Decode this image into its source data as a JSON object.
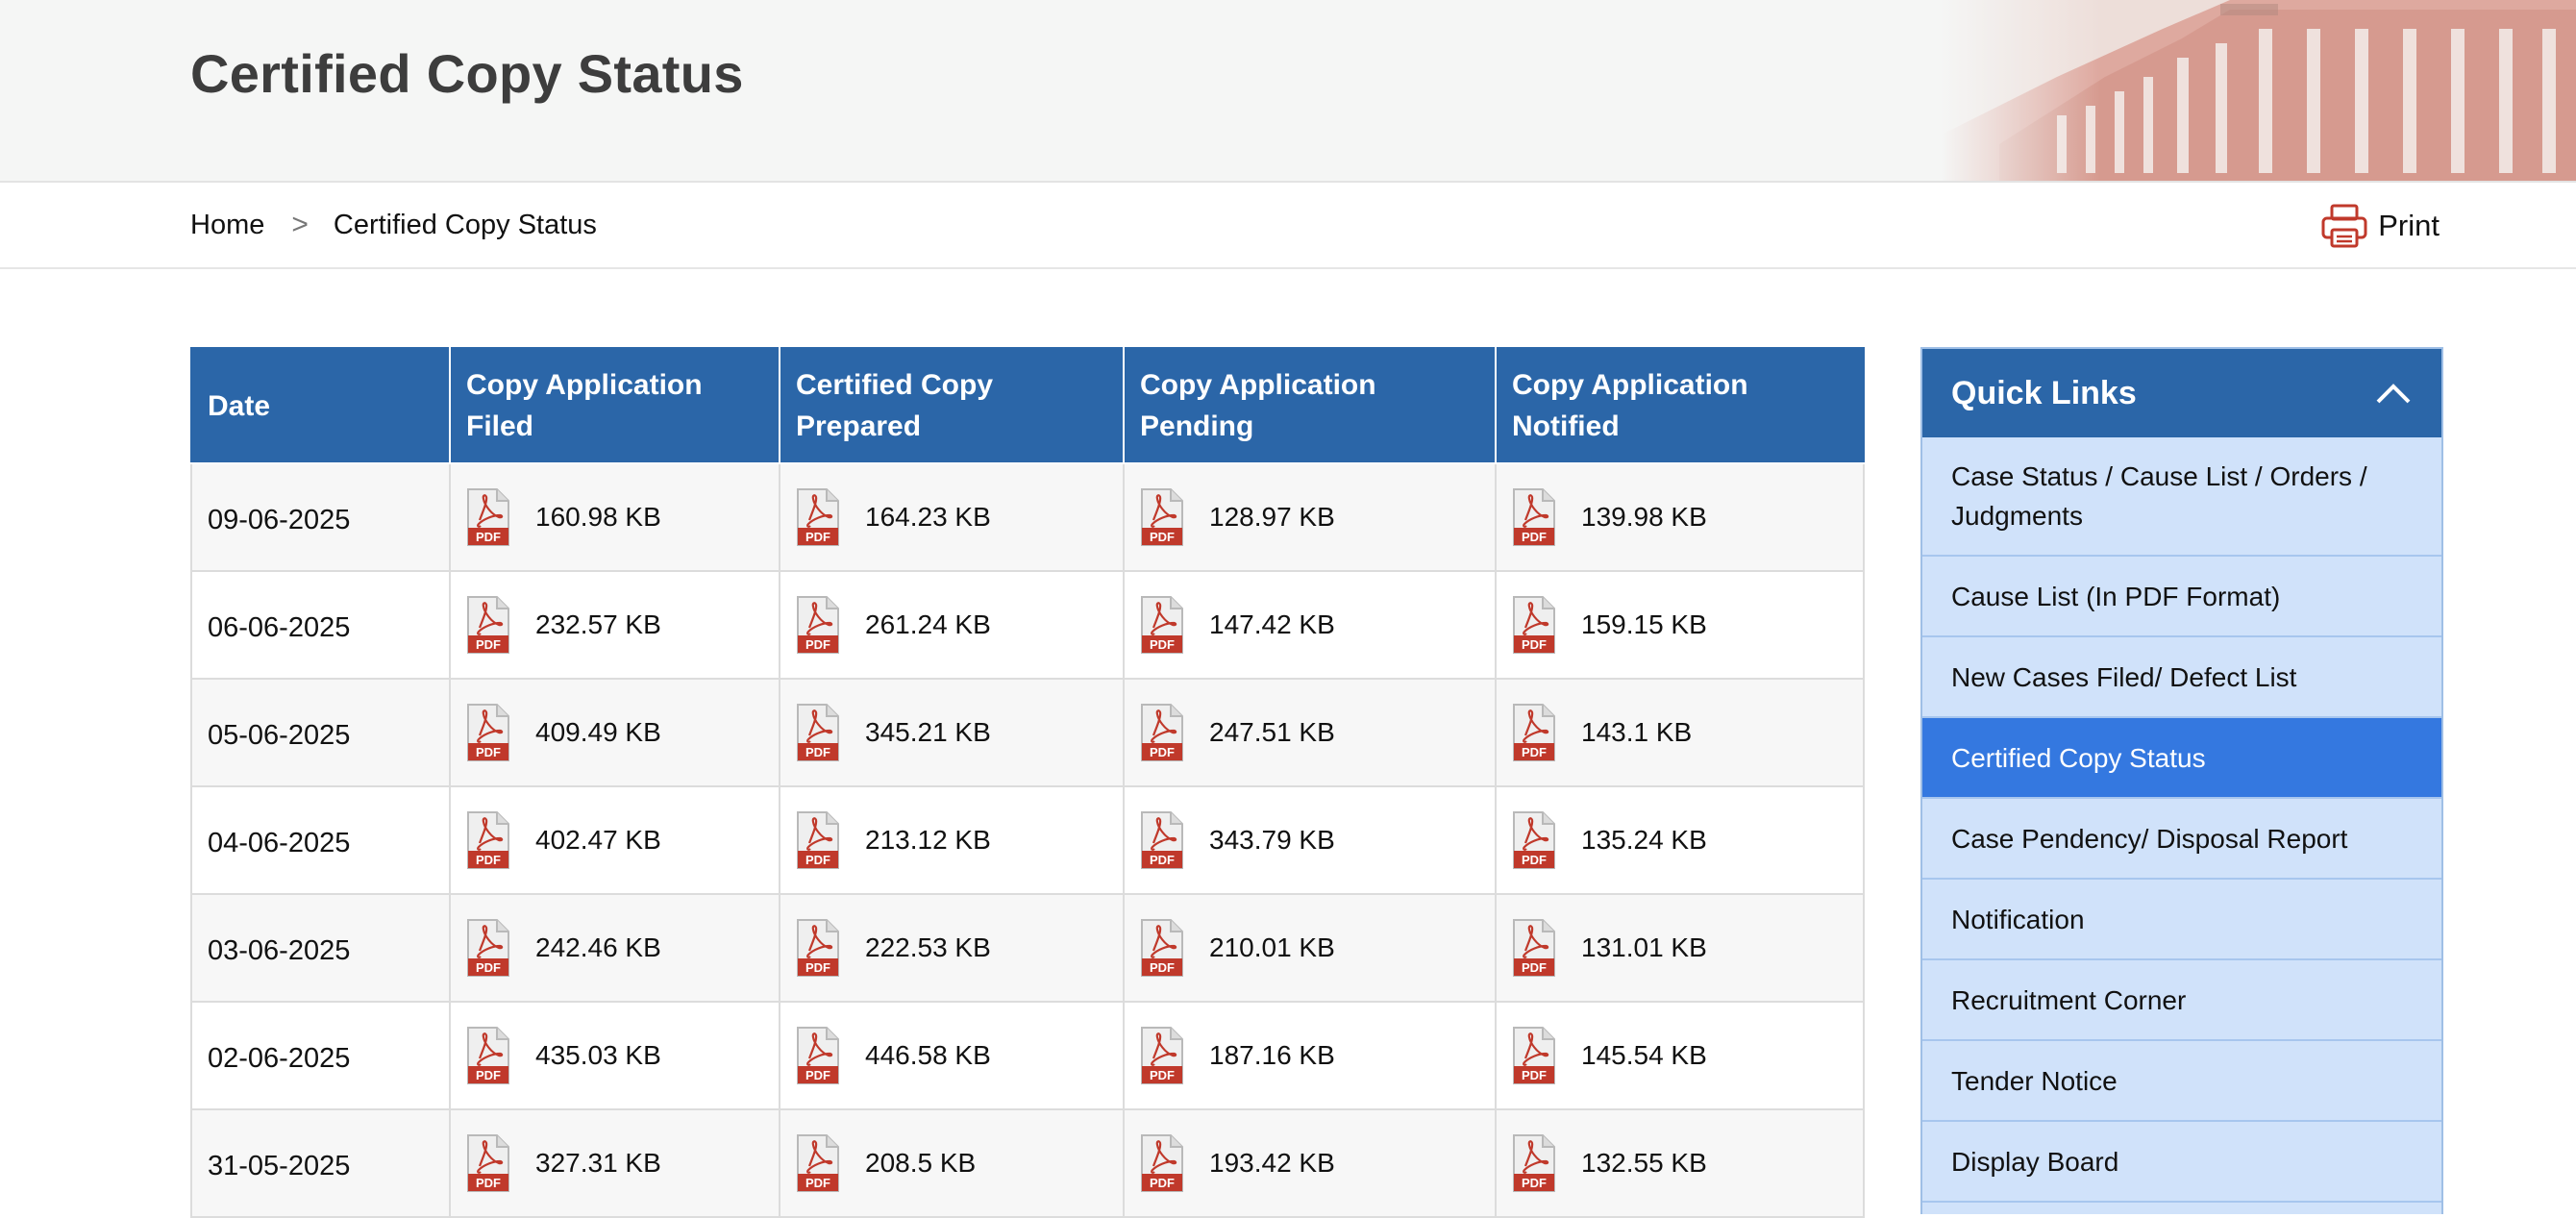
{
  "header": {
    "title": "Certified Copy Status"
  },
  "breadcrumb": {
    "home": "Home",
    "separator": ">",
    "current": "Certified Copy Status"
  },
  "print": {
    "label": "Print",
    "icon": "printer-icon"
  },
  "table": {
    "columns": [
      "Date",
      "Copy Application Filed",
      "Certified Copy Prepared",
      "Copy Application Pending",
      "Copy Application Notified"
    ],
    "file_icon": "pdf-file-icon",
    "rows": [
      {
        "date": "09-06-2025",
        "files": [
          "160.98 KB",
          "164.23 KB",
          "128.97 KB",
          "139.98 KB"
        ]
      },
      {
        "date": "06-06-2025",
        "files": [
          "232.57 KB",
          "261.24 KB",
          "147.42 KB",
          "159.15 KB"
        ]
      },
      {
        "date": "05-06-2025",
        "files": [
          "409.49 KB",
          "345.21 KB",
          "247.51 KB",
          "143.1 KB"
        ]
      },
      {
        "date": "04-06-2025",
        "files": [
          "402.47 KB",
          "213.12 KB",
          "343.79 KB",
          "135.24 KB"
        ]
      },
      {
        "date": "03-06-2025",
        "files": [
          "242.46 KB",
          "222.53 KB",
          "210.01 KB",
          "131.01 KB"
        ]
      },
      {
        "date": "02-06-2025",
        "files": [
          "435.03 KB",
          "446.58 KB",
          "187.16 KB",
          "145.54 KB"
        ]
      },
      {
        "date": "31-05-2025",
        "files": [
          "327.31 KB",
          "208.5 KB",
          "193.42 KB",
          "132.55 KB"
        ]
      }
    ]
  },
  "quick_links": {
    "title": "Quick Links",
    "toggle_icon": "chevron-up-icon",
    "items": [
      {
        "label": "Case Status / Cause List / Orders / Judgments",
        "active": false
      },
      {
        "label": "Cause List (In PDF Format)",
        "active": false
      },
      {
        "label": "New Cases Filed/ Defect List",
        "active": false
      },
      {
        "label": "Certified Copy Status",
        "active": true
      },
      {
        "label": "Case Pendency/ Disposal Report",
        "active": false
      },
      {
        "label": "Notification",
        "active": false
      },
      {
        "label": "Recruitment Corner",
        "active": false
      },
      {
        "label": "Tender Notice",
        "active": false
      },
      {
        "label": "Display Board",
        "active": false
      }
    ]
  },
  "colors": {
    "header_blue": "#2b66a8",
    "active_link": "#3478e0",
    "quick_link_bg": "#d0e2fa",
    "pdf_red": "#c0392b"
  }
}
